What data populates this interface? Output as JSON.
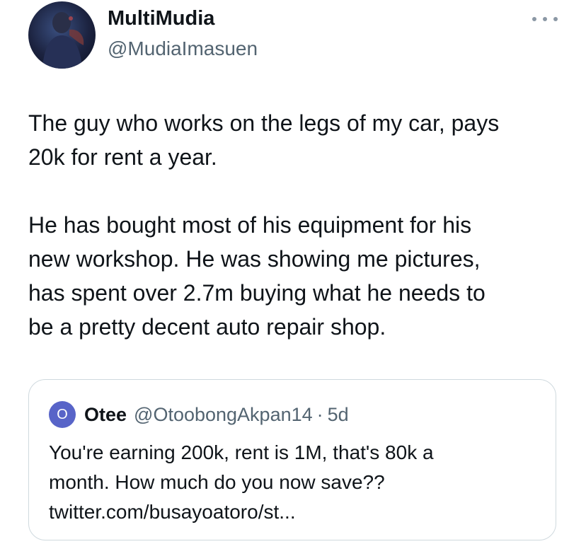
{
  "author": {
    "display_name": "MultiMudia",
    "handle": "@MudiaImasuen"
  },
  "more_icon": "more-horizontal-icon",
  "tweet": {
    "paragraphs": [
      "The guy who works on the legs of my car, pays\n20k for rent a year.",
      "He has bought most of his equipment for his\nnew workshop.  He was showing me pictures,\nhas spent over 2.7m buying what he needs to\nbe a pretty decent auto repair shop."
    ]
  },
  "quote": {
    "avatar_letter": "O",
    "display_name": "Otee",
    "handle": "@OtoobongAkpan14",
    "separator": "·",
    "time": "5d",
    "text": "You're earning 200k, rent is 1M, that's 80k a\nmonth. How much do you now save??\ntwitter.com/busayoatoro/st..."
  },
  "colors": {
    "text_primary": "#0f1419",
    "text_secondary": "#536471",
    "border": "#cfd9de",
    "quote_avatar": "#5864c8"
  }
}
